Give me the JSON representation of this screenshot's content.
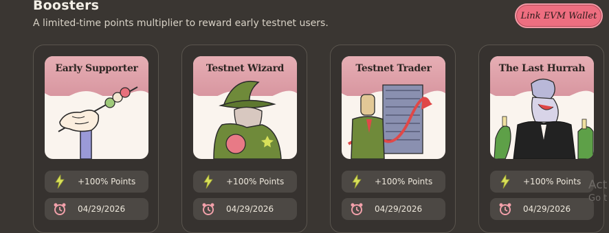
{
  "header": {
    "title": "Boosters",
    "subtitle": "A limited-time points multiplier to reward early testnet users.",
    "link_wallet_label": "Link EVM Wallet"
  },
  "colors": {
    "background": "#3a3632",
    "card_border": "#5a554e",
    "pill_background": "#4c4844",
    "accent_pink": "#ee6e80",
    "bolt_yellow": "#d8e05a",
    "clock_pink": "#f2a0aa"
  },
  "boosters": [
    {
      "name": "Early Supporter",
      "bonus": "+100% Points",
      "date": "04/29/2026",
      "icon": "bolt-icon",
      "date_icon": "alarm-clock-icon"
    },
    {
      "name": "Testnet Wizard",
      "bonus": "+100% Points",
      "date": "04/29/2026",
      "icon": "bolt-icon",
      "date_icon": "alarm-clock-icon"
    },
    {
      "name": "Testnet Trader",
      "bonus": "+100% Points",
      "date": "04/29/2026",
      "icon": "bolt-icon",
      "date_icon": "alarm-clock-icon"
    },
    {
      "name": "The Last Hurrah",
      "bonus": "+100% Points",
      "date": "04/29/2026",
      "icon": "bolt-icon",
      "date_icon": "alarm-clock-icon"
    }
  ],
  "watermark": {
    "line1": "Act",
    "line2": "Go t"
  }
}
